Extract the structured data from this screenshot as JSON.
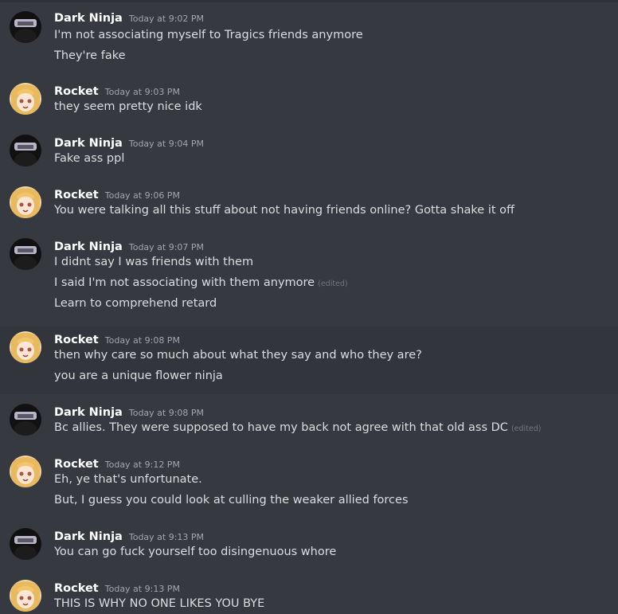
{
  "users": {
    "dark_ninja": {
      "name": "Dark Ninja",
      "avatar_icon": "ninja-avatar-icon"
    },
    "rocket": {
      "name": "Rocket",
      "avatar_icon": "anime-girl-avatar-icon"
    }
  },
  "edited_label": "(edited)",
  "messages": [
    {
      "author": "Dark Ninja",
      "time": "Today at 9:02 PM",
      "lines": [
        "I'm not associating myself to Tragics friends anymore",
        "They're fake"
      ]
    },
    {
      "author": "Rocket",
      "time": "Today at 9:03 PM",
      "lines": [
        "they seem pretty nice idk"
      ]
    },
    {
      "author": "Dark Ninja",
      "time": "Today at 9:04 PM",
      "lines": [
        "Fake ass ppl"
      ]
    },
    {
      "author": "Rocket",
      "time": "Today at 9:06 PM",
      "lines": [
        "You were talking all this stuff about not having friends online?  Gotta shake it off"
      ]
    },
    {
      "author": "Dark Ninja",
      "time": "Today at 9:07 PM",
      "lines": [
        "I didnt say I was friends with them",
        "I said I'm not associating with them anymore",
        "Learn to comprehend retard"
      ]
    },
    {
      "author": "Rocket",
      "time": "Today at 9:08 PM",
      "lines": [
        "then why care so much about what they say and who they are?",
        "you are a unique flower ninja"
      ]
    },
    {
      "author": "Dark Ninja",
      "time": "Today at 9:08 PM",
      "lines": [
        "Bc allies. They were supposed to have my back not agree with that old ass DC"
      ]
    },
    {
      "author": "Rocket",
      "time": "Today at 9:12 PM",
      "lines": [
        "Eh, ye that's unfortunate.",
        "But, I guess you could look at culling the weaker allied forces"
      ]
    },
    {
      "author": "Dark Ninja",
      "time": "Today at 9:13 PM",
      "lines": [
        "You can go fuck yourself too disingenuous whore"
      ]
    },
    {
      "author": "Rocket",
      "time": "Today at 9:13 PM",
      "lines": [
        "THIS IS WHY NO ONE LIKES YOU BYE"
      ]
    }
  ]
}
